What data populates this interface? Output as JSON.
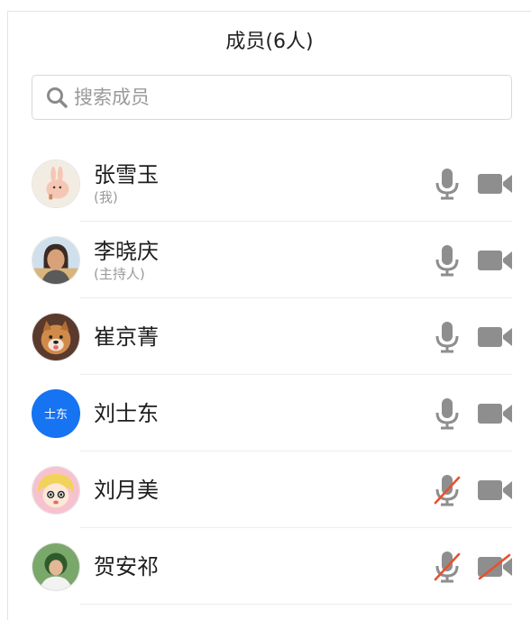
{
  "header": {
    "title": "成员(6人)"
  },
  "search": {
    "placeholder": "搜索成员"
  },
  "colors": {
    "accent_blue": "#1673f2",
    "icon_gray": "#8e8e8e",
    "muted_red": "#e8502f"
  },
  "members": [
    {
      "name": "张雪玉",
      "role": "(我)",
      "avatar": "bunny-illustration-avatar",
      "mic_muted": false,
      "camera_off": false
    },
    {
      "name": "李晓庆",
      "role": "(主持人)",
      "avatar": "person-photo-avatar",
      "mic_muted": false,
      "camera_off": false
    },
    {
      "name": "崔京菁",
      "role": "",
      "avatar": "dog-photo-avatar",
      "mic_muted": false,
      "camera_off": false
    },
    {
      "name": "刘士东",
      "role": "",
      "avatar_text": "士东",
      "avatar": "text-avatar",
      "mic_muted": false,
      "camera_off": false
    },
    {
      "name": "刘月美",
      "role": "",
      "avatar": "cartoon-girl-avatar",
      "mic_muted": true,
      "camera_off": false
    },
    {
      "name": "贺安祁",
      "role": "",
      "avatar": "person-photo-avatar",
      "mic_muted": true,
      "camera_off": true
    }
  ]
}
